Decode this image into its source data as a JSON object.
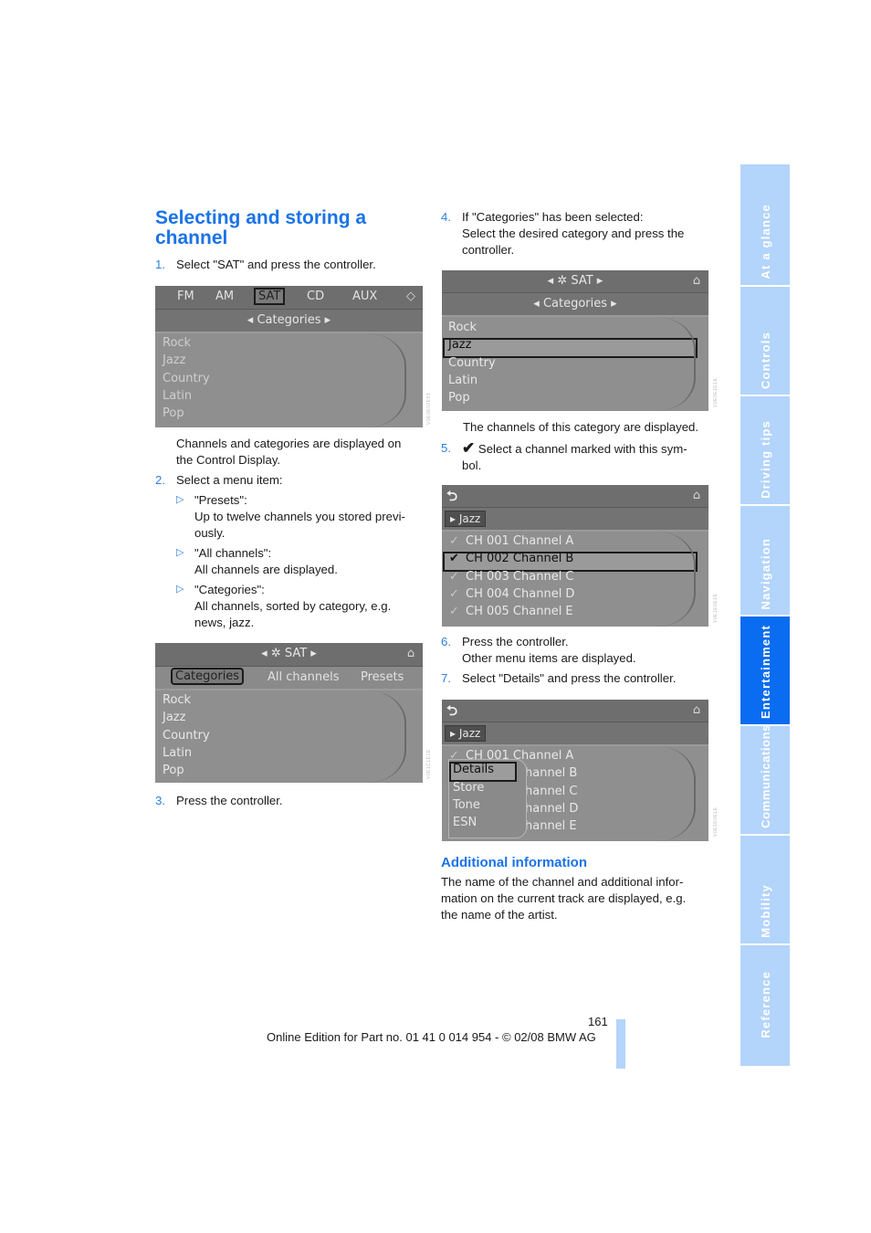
{
  "page": {
    "title": "Selecting and storing a channel",
    "page_number": "161",
    "footer": "Online Edition for Part no. 01 41 0 014 954  - © 02/08 BMW AG"
  },
  "left_column": {
    "step1": {
      "num": "1.",
      "text": "Select \"SAT\" and press the controller."
    },
    "after_screen1": [
      "Channels and categories are displayed on",
      "the Control Display."
    ],
    "step2": {
      "num": "2.",
      "text": "Select a menu item:"
    },
    "bullets": [
      {
        "marker": "▷",
        "label": "\"Presets\":",
        "lines": [
          "Up to twelve channels you stored previ-",
          "ously."
        ]
      },
      {
        "marker": "▷",
        "label": "\"All channels\":",
        "lines": [
          "All channels are displayed."
        ]
      },
      {
        "marker": "▷",
        "label": "\"Categories\":",
        "lines": [
          "All channels, sorted by category, e.g.",
          "news, jazz."
        ]
      }
    ],
    "step3": {
      "num": "3.",
      "text": "Press the controller."
    }
  },
  "right_column": {
    "step4": {
      "num": "4.",
      "lines": [
        "If \"Categories\" has been selected:",
        "Select the desired category and press the",
        "controller."
      ]
    },
    "after_screen3": "The channels of this category are displayed.",
    "step5": {
      "num": "5.",
      "icon": "checkmark-icon",
      "lines": [
        "Select a channel marked with this sym-",
        "bol."
      ]
    },
    "step6": {
      "num": "6.",
      "lines": [
        "Press the controller.",
        "Other menu items are displayed."
      ]
    },
    "step7": {
      "num": "7.",
      "text": "Select \"Details\" and press the controller."
    },
    "additional": {
      "heading": "Additional information",
      "lines": [
        "The name of the channel and additional infor-",
        "mation on the current track are displayed, e.g.",
        "the name of the artist."
      ]
    }
  },
  "screens": {
    "s1": {
      "tabs": [
        "FM",
        "AM",
        "SAT",
        "CD",
        "AUX"
      ],
      "selected_tab": "SAT",
      "submenu": "Categories",
      "items": [
        "Rock",
        "Jazz",
        "Country",
        "Latin",
        "Pop"
      ]
    },
    "s2": {
      "header": "SAT",
      "tabs": [
        "Categories",
        "All channels",
        "Presets"
      ],
      "selected_tab": "Categories",
      "items": [
        "Rock",
        "Jazz",
        "Country",
        "Latin",
        "Pop"
      ]
    },
    "s3": {
      "header": "SAT",
      "submenu": "Categories",
      "items": [
        "Rock",
        "Jazz",
        "Country",
        "Latin",
        "Pop"
      ],
      "selected_item": "Jazz"
    },
    "s4": {
      "crumb": "Jazz",
      "channels": [
        "CH 001 Channel A",
        "CH 002 Channel B",
        "CH 003 Channel C",
        "CH 004 Channel D",
        "CH 005 Channel E"
      ],
      "selected_channel": "CH 002 Channel B"
    },
    "s5": {
      "crumb": "Jazz",
      "channels_visible": [
        "CH 001 Channel A",
        "hannel B",
        "hannel C",
        "hannel D",
        "hannel E"
      ],
      "popup_items": [
        "Details",
        "Store",
        "Tone",
        "ESN"
      ],
      "popup_selected": "Details"
    }
  },
  "side_tabs": [
    {
      "label": "At a glance",
      "active": false
    },
    {
      "label": "Controls",
      "active": false
    },
    {
      "label": "Driving tips",
      "active": false
    },
    {
      "label": "Navigation",
      "active": false
    },
    {
      "label": "Entertainment",
      "active": true
    },
    {
      "label": "Communications",
      "active": false
    },
    {
      "label": "Mobility",
      "active": false
    },
    {
      "label": "Reference",
      "active": false
    }
  ],
  "colors": {
    "heading_blue": "#1a73e8",
    "step_number_blue": "#2f7fe0",
    "side_tab": "#b3d4fb",
    "side_tab_active": "#0a6cf0"
  }
}
